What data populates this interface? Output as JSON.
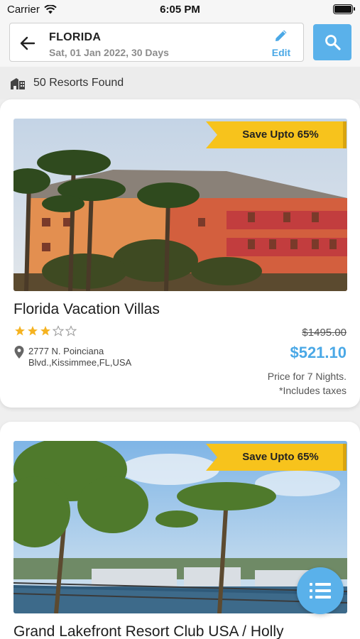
{
  "status_bar": {
    "carrier": "Carrier",
    "time": "6:05 PM"
  },
  "search": {
    "location": "FLORIDA",
    "dates": "Sat,  01 Jan 2022,  30 Days",
    "edit_label": "Edit"
  },
  "results": {
    "count_text": "50 Resorts Found"
  },
  "resorts": [
    {
      "discount": "Save Upto 65%",
      "name": "Florida Vacation Villas",
      "rating": 3,
      "rating_max": 5,
      "address_line1": "2777 N. Poinciana",
      "address_line2": "Blvd.,Kissimmee,FL,USA",
      "original_price": "$1495.00",
      "price": "$521.10",
      "price_note_1": "Price for 7 Nights.",
      "price_note_2": "*Includes taxes"
    },
    {
      "discount": "Save Upto 65%",
      "name": "Grand Lakefront Resort Club USA / Holly"
    }
  ],
  "colors": {
    "accent": "#4aa8e6",
    "ribbon": "#f7c31c",
    "star": "#f5b321"
  },
  "icons": [
    "back-arrow-icon",
    "pencil-icon",
    "search-icon",
    "building-icon",
    "location-pin-icon",
    "star-icon",
    "list-icon",
    "wifi-icon",
    "battery-icon"
  ]
}
